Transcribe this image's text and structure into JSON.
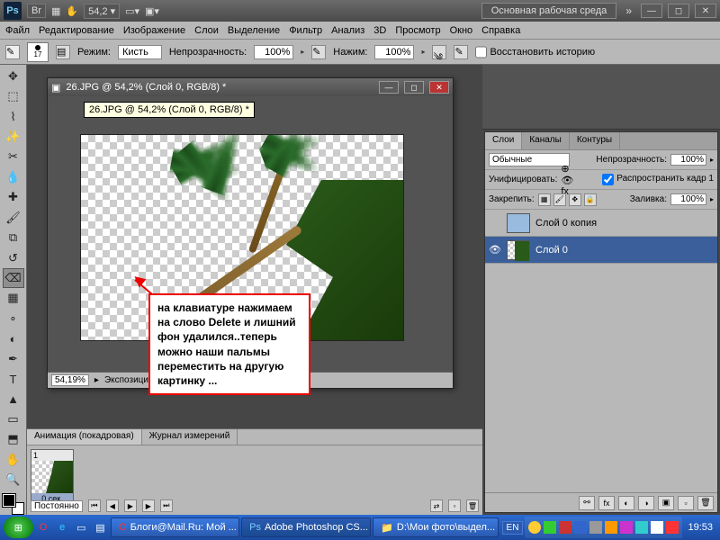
{
  "titlebar": {
    "app": "Ps",
    "docs": "Br",
    "zoom": "54,2",
    "workspace_label": "Основная рабочая среда"
  },
  "menu": {
    "file": "Файл",
    "edit": "Редактирование",
    "image": "Изображение",
    "layer": "Слои",
    "select": "Выделение",
    "filter": "Фильтр",
    "analysis": "Анализ",
    "threeD": "3D",
    "view": "Просмотр",
    "window": "Окно",
    "help": "Справка"
  },
  "options": {
    "brush_size": "17",
    "mode_label": "Режим:",
    "mode_value": "Кисть",
    "opacity_label": "Непрозрачность:",
    "opacity_value": "100%",
    "flow_label": "Нажим:",
    "flow_value": "100%",
    "restore_label": "Восстановить историю"
  },
  "document": {
    "title": "26.JPG @ 54,2% (Слой 0, RGB/8) *",
    "tooltip": "26.JPG @ 54,2% (Слой 0, RGB/8) *",
    "status_zoom": "54,19%",
    "status_info": "Экспозиция работ"
  },
  "annotation": {
    "text": "на клавиатуре нажимаем на слово Delete и лишний фон удалился..теперь можно наши пальмы переместить на другую картинку ..."
  },
  "animation": {
    "tab1": "Анимация (покадровая)",
    "tab2": "Журнал измерений",
    "frame_num": "1",
    "frame_dur": "0 сек.",
    "loop": "Постоянно"
  },
  "layers": {
    "tab_layers": "Слои",
    "tab_channels": "Каналы",
    "tab_paths": "Контуры",
    "blend": "Обычные",
    "opacity_label": "Непрозрачность:",
    "opacity_value": "100%",
    "unify_label": "Унифицировать:",
    "propagate_label": "Распространить кадр 1",
    "lock_label": "Закрепить:",
    "fill_label": "Заливка:",
    "fill_value": "100%",
    "layer1": "Слой 0 копия",
    "layer2": "Слой 0"
  },
  "taskbar": {
    "task1": "Блоги@Mail.Ru: Мой ...",
    "task2": "Adobe Photoshop CS...",
    "task3": "D:\\Мои фото\\выдел...",
    "lang": "EN",
    "clock": "19:53"
  }
}
